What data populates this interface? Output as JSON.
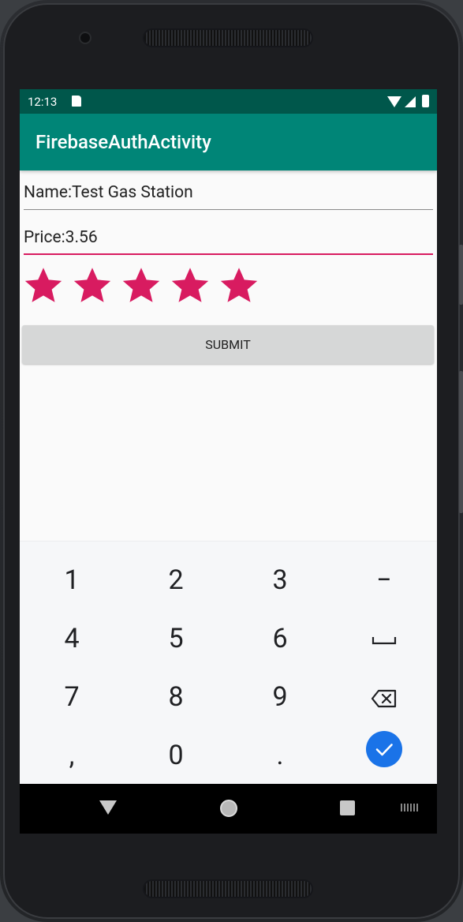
{
  "status_bar": {
    "time": "12:13",
    "icons": [
      "sd-card-icon",
      "wifi-icon",
      "signal-icon",
      "battery-icon"
    ]
  },
  "app_bar": {
    "title": "FirebaseAuthActivity"
  },
  "form": {
    "name_value": "Name:Test Gas Station",
    "price_value": "Price:3.56",
    "rating": {
      "value": 5,
      "max": 5,
      "color": "#d81b60"
    },
    "submit_label": "SUBMIT"
  },
  "keyboard": {
    "rows": [
      [
        "1",
        "2",
        "3",
        "−"
      ],
      [
        "4",
        "5",
        "6",
        "space"
      ],
      [
        "7",
        "8",
        "9",
        "backspace"
      ],
      [
        ",",
        "0",
        ".",
        "done"
      ]
    ],
    "key_labels": {
      "k1": "1",
      "k2": "2",
      "k3": "3",
      "minus": "−",
      "k4": "4",
      "k5": "5",
      "k6": "6",
      "k7": "7",
      "k8": "8",
      "k9": "9",
      "comma": ",",
      "k0": "0",
      "period": "."
    },
    "done_color": "#1a73e8"
  },
  "nav_bar": {
    "buttons": [
      "back-icon",
      "home-icon",
      "recents-icon",
      "keyboard-switch-icon"
    ]
  },
  "colors": {
    "status_bar": "#00574b",
    "app_bar": "#008577",
    "accent": "#d81b60",
    "button": "#d6d7d7"
  }
}
